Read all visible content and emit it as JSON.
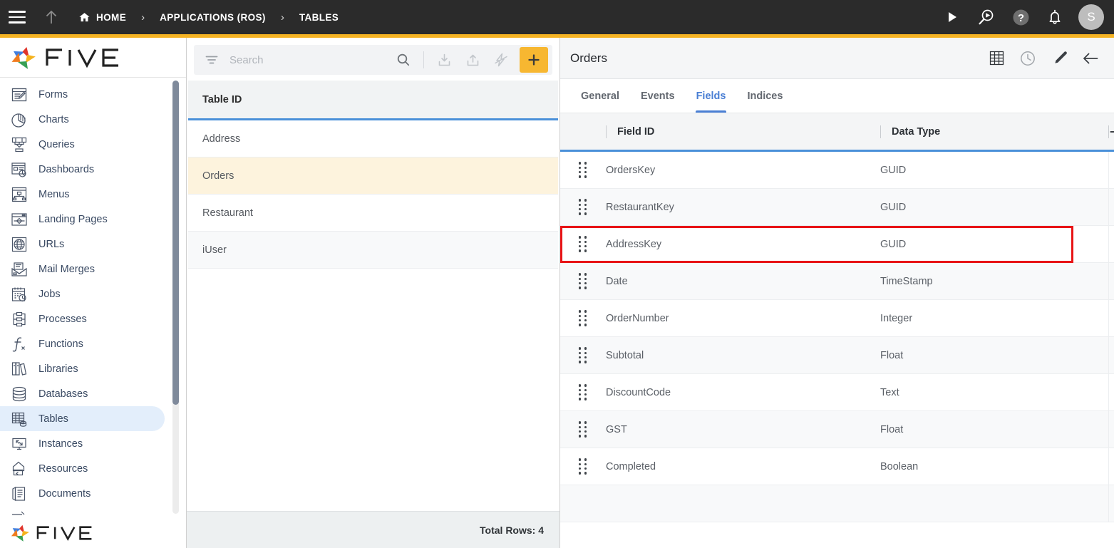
{
  "topbar": {
    "menu_icon": "hamburger-menu-icon",
    "up_icon": "arrow-up-icon",
    "breadcrumb": [
      {
        "label": "HOME",
        "icon": "home-icon"
      },
      {
        "label": "APPLICATIONS (ROS)",
        "icon": ""
      },
      {
        "label": "TABLES",
        "icon": ""
      }
    ],
    "separator": "›",
    "actions": [
      {
        "name": "run-icon",
        "title": "Run"
      },
      {
        "name": "debug-run-icon",
        "title": "Debug"
      },
      {
        "name": "help-icon",
        "title": "Help"
      },
      {
        "name": "notifications-bell-icon",
        "title": "Notifications"
      }
    ],
    "avatar_initial": "S",
    "accent_color": "#f5b324",
    "background_color": "#2b2b2b"
  },
  "sidebar": {
    "logo_text": "FIVE",
    "footer_logo_text": "FIVE",
    "items": [
      {
        "label": "Forms",
        "icon": "forms-icon",
        "active": false
      },
      {
        "label": "Charts",
        "icon": "charts-icon",
        "active": false
      },
      {
        "label": "Queries",
        "icon": "queries-icon",
        "active": false
      },
      {
        "label": "Dashboards",
        "icon": "dashboards-icon",
        "active": false
      },
      {
        "label": "Menus",
        "icon": "menus-icon",
        "active": false
      },
      {
        "label": "Landing Pages",
        "icon": "landing-pages-icon",
        "active": false
      },
      {
        "label": "URLs",
        "icon": "urls-icon",
        "active": false
      },
      {
        "label": "Mail Merges",
        "icon": "mail-merges-icon",
        "active": false
      },
      {
        "label": "Jobs",
        "icon": "jobs-icon",
        "active": false
      },
      {
        "label": "Processes",
        "icon": "processes-icon",
        "active": false
      },
      {
        "label": "Functions",
        "icon": "functions-icon",
        "active": false
      },
      {
        "label": "Libraries",
        "icon": "libraries-icon",
        "active": false
      },
      {
        "label": "Databases",
        "icon": "databases-icon",
        "active": false
      },
      {
        "label": "Tables",
        "icon": "tables-icon",
        "active": true
      },
      {
        "label": "Instances",
        "icon": "instances-icon",
        "active": false
      },
      {
        "label": "Resources",
        "icon": "resources-icon",
        "active": false
      },
      {
        "label": "Documents",
        "icon": "documents-icon",
        "active": false
      }
    ]
  },
  "list_panel": {
    "search": {
      "placeholder": "Search",
      "value": ""
    },
    "toolbar": [
      {
        "name": "filter-icon"
      },
      {
        "name": "search-icon"
      },
      {
        "name": "import-icon"
      },
      {
        "name": "export-icon"
      },
      {
        "name": "flash-icon"
      },
      {
        "name": "add-icon",
        "label": "+"
      }
    ],
    "column_header": "Table ID",
    "rows": [
      {
        "label": "Address",
        "selected": false
      },
      {
        "label": "Orders",
        "selected": true
      },
      {
        "label": "Restaurant",
        "selected": false
      },
      {
        "label": "iUser",
        "selected": false
      }
    ],
    "footer_text": "Total Rows: 4"
  },
  "detail_panel": {
    "title": "Orders",
    "header_icons": [
      {
        "name": "grid-table-icon"
      },
      {
        "name": "history-clock-icon"
      },
      {
        "name": "edit-pencil-icon"
      },
      {
        "name": "back-arrow-icon"
      }
    ],
    "tabs": [
      {
        "label": "General",
        "active": false
      },
      {
        "label": "Events",
        "active": false
      },
      {
        "label": "Fields",
        "active": true
      },
      {
        "label": "Indices",
        "active": false
      }
    ],
    "grid": {
      "columns": [
        "Field ID",
        "Data Type"
      ],
      "add_column_icon": "add-field-icon",
      "rows": [
        {
          "field_id": "OrdersKey",
          "data_type": "GUID",
          "highlighted": false
        },
        {
          "field_id": "RestaurantKey",
          "data_type": "GUID",
          "highlighted": false
        },
        {
          "field_id": "AddressKey",
          "data_type": "GUID",
          "highlighted": true
        },
        {
          "field_id": "Date",
          "data_type": "TimeStamp",
          "highlighted": false
        },
        {
          "field_id": "OrderNumber",
          "data_type": "Integer",
          "highlighted": false
        },
        {
          "field_id": "Subtotal",
          "data_type": "Float",
          "highlighted": false
        },
        {
          "field_id": "DiscountCode",
          "data_type": "Text",
          "highlighted": false
        },
        {
          "field_id": "GST",
          "data_type": "Float",
          "highlighted": false
        },
        {
          "field_id": "Completed",
          "data_type": "Boolean",
          "highlighted": false
        }
      ]
    }
  },
  "colors": {
    "header_bg": "#2b2b2b",
    "accent_yellow": "#f5b324",
    "selection_cream": "#fdf3dd",
    "active_blue": "#4a7fd4",
    "grid_underline_blue": "#4a90d9",
    "highlight_red": "#e81416",
    "sidebar_active_blue": "#e3eefb"
  }
}
